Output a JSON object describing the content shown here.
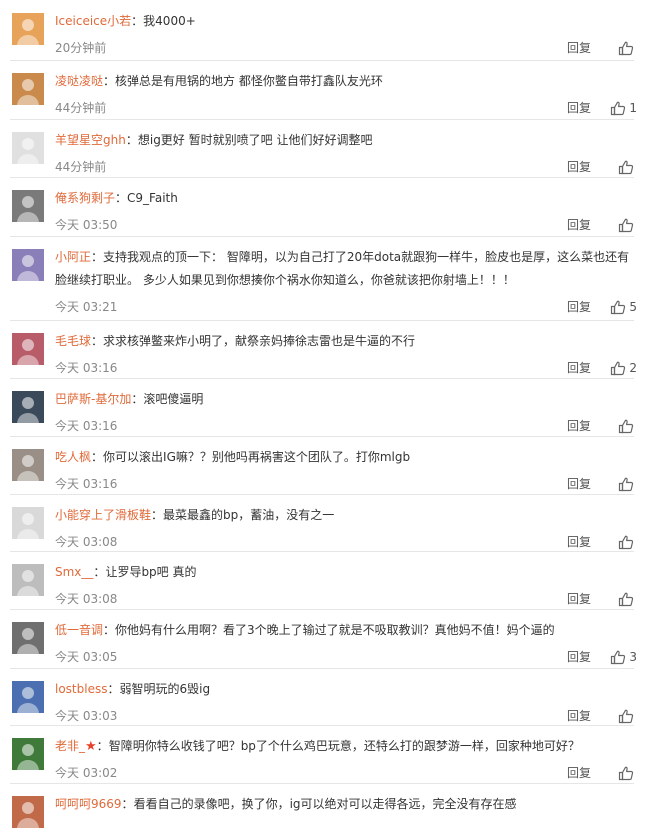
{
  "ui": {
    "reply_label": "回复",
    "separator": "：",
    "icons": {
      "like": "thumbs-up-icon",
      "avatar": "user-avatar"
    },
    "colors": {
      "username": "#e06a3a",
      "text": "#333333",
      "time": "#888888",
      "divider": "#e6e6e6"
    }
  },
  "comments": [
    {
      "user": "Iceiceice小若",
      "text": "我4000+",
      "time": "20分钟前",
      "likes": ""
    },
    {
      "user": "凌哒凌哒",
      "text": "核弹总是有甩锅的地方 都怪你鳖自带打鑫队友光环",
      "time": "44分钟前",
      "likes": "1"
    },
    {
      "user": "羊望星空ghh",
      "text": "想ig更好 暂时就别喷了吧 让他们好好调整吧",
      "time": "44分钟前",
      "likes": ""
    },
    {
      "user": "俺系狗剩子",
      "text": "C9_Faith",
      "time": "今天 03:50",
      "likes": ""
    },
    {
      "user": "小阿正",
      "text": "支持我观点的顶一下： 智障明，以为自己打了20年dota就跟狗一样牛，脸皮也是厚，这么菜也还有脸继续打职业。 多少人如果见到你想揍你个祸水你知道么，你爸就该把你射墙上！！！",
      "time": "今天 03:21",
      "likes": "5"
    },
    {
      "user": "毛毛球",
      "text": "求求核弹鳖来炸小明了，献祭亲妈捧徐志雷也是牛逼的不行",
      "time": "今天 03:16",
      "likes": "2"
    },
    {
      "user": "巴萨斯-基尔加",
      "text": "滚吧傻逼明",
      "time": "今天 03:16",
      "likes": ""
    },
    {
      "user": "吃人枫",
      "text": "你可以滚出IG嘛？？别他吗再祸害这个团队了。打你mlgb",
      "time": "今天 03:16",
      "likes": ""
    },
    {
      "user": "小能穿上了滑板鞋",
      "text": "最菜最鑫的bp，蓄油，没有之一",
      "time": "今天 03:08",
      "likes": ""
    },
    {
      "user": "Smx__",
      "text": "让罗导bp吧 真的",
      "time": "今天 03:08",
      "likes": ""
    },
    {
      "user": "低一音调",
      "text": "你他妈有什么用啊？看了3个晚上了输过了就是不吸取教训？真他妈不值！妈个逼的",
      "time": "今天 03:05",
      "likes": "3"
    },
    {
      "user": "lostbless",
      "text": "弱智明玩的6毁ig",
      "time": "今天 03:03",
      "likes": ""
    },
    {
      "user": "老非_",
      "badge": "★",
      "text": "智障明你特么收钱了吧？bp了个什么鸡巴玩意，还特么打的跟梦游一样，回家种地可好？",
      "time": "今天 03:02",
      "likes": ""
    },
    {
      "user": "呵呵呵9669",
      "text": "看看自己的录像吧，换了你，ig可以绝对可以走得各远，完全没有存在感",
      "time": "",
      "likes": ""
    }
  ]
}
